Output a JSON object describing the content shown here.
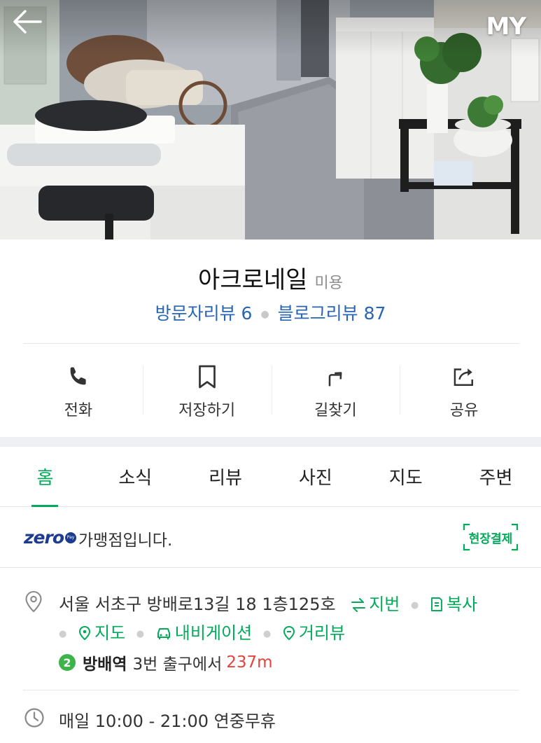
{
  "header": {
    "my_label": "MY"
  },
  "place": {
    "name": "아크로네일",
    "category": "미용",
    "visitor_reviews_label": "방문자리뷰",
    "visitor_reviews_count": "6",
    "blog_reviews_label": "블로그리뷰",
    "blog_reviews_count": "87"
  },
  "actions": [
    {
      "label": "전화",
      "icon": "phone-icon"
    },
    {
      "label": "저장하기",
      "icon": "bookmark-icon"
    },
    {
      "label": "길찾기",
      "icon": "directions-icon"
    },
    {
      "label": "공유",
      "icon": "share-icon"
    }
  ],
  "tabs": [
    {
      "label": "홈",
      "active": true
    },
    {
      "label": "소식",
      "active": false
    },
    {
      "label": "리뷰",
      "active": false
    },
    {
      "label": "사진",
      "active": false
    },
    {
      "label": "지도",
      "active": false
    },
    {
      "label": "주변",
      "active": false
    }
  ],
  "zeropay": {
    "logo_text": "zero",
    "logo_sub": "Pay",
    "text": "가맹점입니다.",
    "badge": "현장결제"
  },
  "address": {
    "text": "서울 서초구 방배로13길 18 1층125호",
    "jibun_label": "지번",
    "copy_label": "복사",
    "map_label": "지도",
    "navigation_label": "내비게이션",
    "streetview_label": "거리뷰"
  },
  "transit": {
    "line_number": "2",
    "station": "방배역",
    "exit": "3번 출구에서",
    "distance": "237m"
  },
  "hours": {
    "text": "매일 10:00 - 21:00 연중무휴"
  },
  "colors": {
    "accent_green": "#03aa5a",
    "review_blue": "#2866b5",
    "distance_red": "#e5433c",
    "line2_green": "#3cb44a"
  }
}
